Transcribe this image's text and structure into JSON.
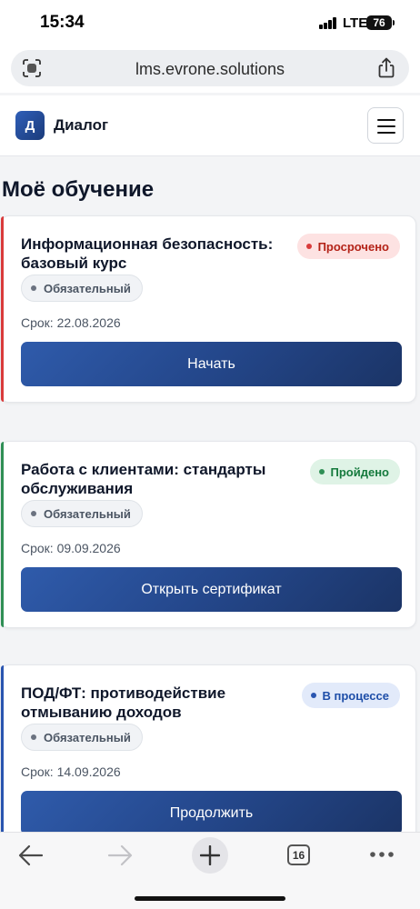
{
  "status_bar": {
    "time": "15:34",
    "network": "LTE",
    "battery": "76"
  },
  "browser": {
    "url": "lms.evrone.solutions"
  },
  "app": {
    "logo_letter": "Д",
    "name": "Диалог"
  },
  "page": {
    "title": "Моё обучение"
  },
  "courses": [
    {
      "title": "Информационная безопасность: базовый курс",
      "status": "Просрочено",
      "required_label": "Обязательный",
      "deadline": "Срок: 22.08.2026",
      "action": "Начать"
    },
    {
      "title": "Работа с клиентами: стандарты обслуживания",
      "status": "Пройдено",
      "required_label": "Обязательный",
      "deadline": "Срок: 09.09.2026",
      "action": "Открыть сертификат"
    },
    {
      "title": "ПОД/ФТ: противодействие отмыванию доходов",
      "status": "В процессе",
      "required_label": "Обязательный",
      "deadline": "Срок: 14.09.2026",
      "action": "Продолжить"
    }
  ],
  "status_colors": {
    "overdue_bg": "#fde2e2",
    "overdue_text": "#b42318",
    "overdue_accent": "#d93b3b",
    "done_bg": "#dff3e6",
    "done_text": "#157a3d",
    "done_accent": "#2f8f55",
    "progress_bg": "#e2eafa",
    "progress_text": "#1e4ea8",
    "progress_accent": "#2a55b0"
  },
  "toolbar": {
    "back_icon": "arrow-left-icon",
    "forward_icon": "arrow-right-icon",
    "new_tab_icon": "plus-icon",
    "tab_count": "16",
    "more_icon": "ellipsis-icon"
  }
}
